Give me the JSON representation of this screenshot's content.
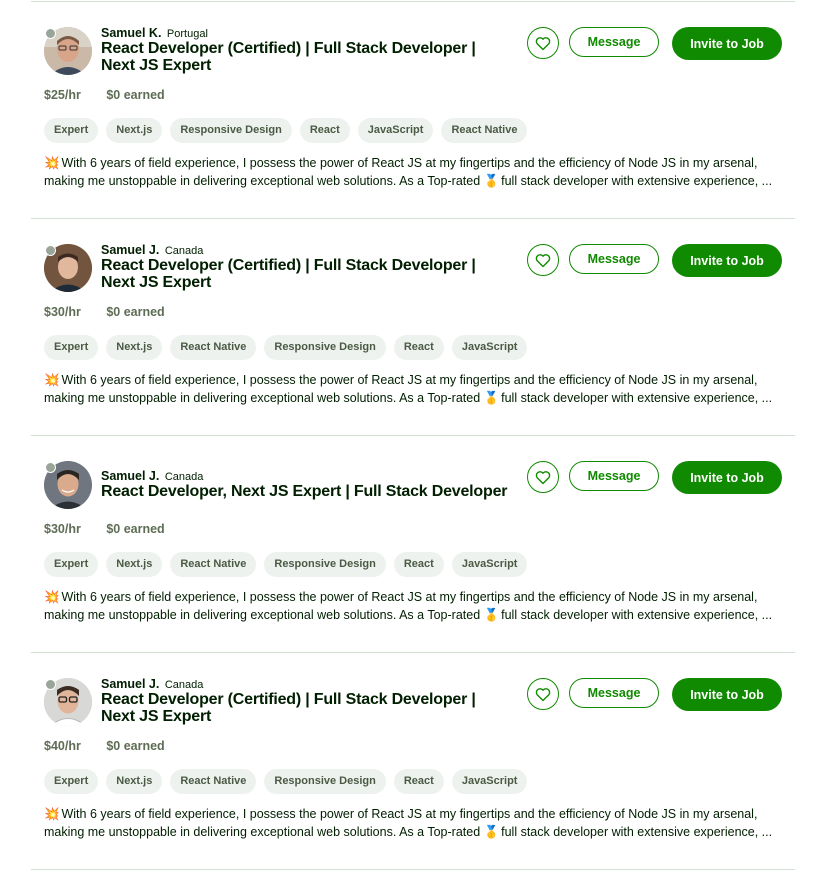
{
  "colors": {
    "brand_green": "#108a00",
    "chip_bg": "#eef2ee",
    "divider": "#d5e0d5",
    "status_offline": "#9aa59a"
  },
  "actions": {
    "favorite_icon": "heart-outline-icon",
    "message_label": "Message",
    "invite_label": "Invite to Job"
  },
  "freelancers": [
    {
      "name": "Samuel K.",
      "country": "Portugal",
      "title": "React Developer (Certified) | Full Stack Developer | Next JS Expert",
      "rate": "$25/hr",
      "earned": "$0 earned",
      "skills": [
        "Expert",
        "Next.js",
        "Responsive Design",
        "React",
        "JavaScript",
        "React Native"
      ],
      "desc_emoji": "💥",
      "desc_line1": "With 6 years of field experience, I possess the power of React JS at my fingertips and the efficiency of Node JS in my arsenal,",
      "desc_line2_a": "making me unstoppable in delivering exceptional web solutions. As a Top-rated",
      "desc_medal": "🥇",
      "desc_line2_b": "full stack developer with extensive experience, ..."
    },
    {
      "name": "Samuel J.",
      "country": "Canada",
      "title": "React Developer (Certified) | Full Stack Developer | Next JS Expert",
      "rate": "$30/hr",
      "earned": "$0 earned",
      "skills": [
        "Expert",
        "Next.js",
        "React Native",
        "Responsive Design",
        "React",
        "JavaScript"
      ],
      "desc_emoji": "💥",
      "desc_line1": "With 6 years of field experience, I possess the power of React JS at my fingertips and the efficiency of Node JS in my arsenal,",
      "desc_line2_a": "making me unstoppable in delivering exceptional web solutions. As a Top-rated",
      "desc_medal": "🥇",
      "desc_line2_b": "full stack developer with extensive experience, ..."
    },
    {
      "name": "Samuel J.",
      "country": "Canada",
      "title": "React Developer, Next JS Expert | Full Stack Developer",
      "rate": "$30/hr",
      "earned": "$0 earned",
      "skills": [
        "Expert",
        "Next.js",
        "React Native",
        "Responsive Design",
        "React",
        "JavaScript"
      ],
      "desc_emoji": "💥",
      "desc_line1": "With 6 years of field experience, I possess the power of React JS at my fingertips and the efficiency of Node JS in my arsenal,",
      "desc_line2_a": "making me unstoppable in delivering exceptional web solutions. As a Top-rated",
      "desc_medal": "🥇",
      "desc_line2_b": "full stack developer with extensive experience, ..."
    },
    {
      "name": "Samuel J.",
      "country": "Canada",
      "title": "React Developer (Certified) | Full Stack Developer | Next JS Expert",
      "rate": "$40/hr",
      "earned": "$0 earned",
      "skills": [
        "Expert",
        "Next.js",
        "React Native",
        "Responsive Design",
        "React",
        "JavaScript"
      ],
      "desc_emoji": "💥",
      "desc_line1": "With 6 years of field experience, I possess the power of React JS at my fingertips and the efficiency of Node JS in my arsenal,",
      "desc_line2_a": "making me unstoppable in delivering exceptional web solutions. As a Top-rated",
      "desc_medal": "🥇",
      "desc_line2_b": "full stack developer with extensive experience, ..."
    }
  ]
}
